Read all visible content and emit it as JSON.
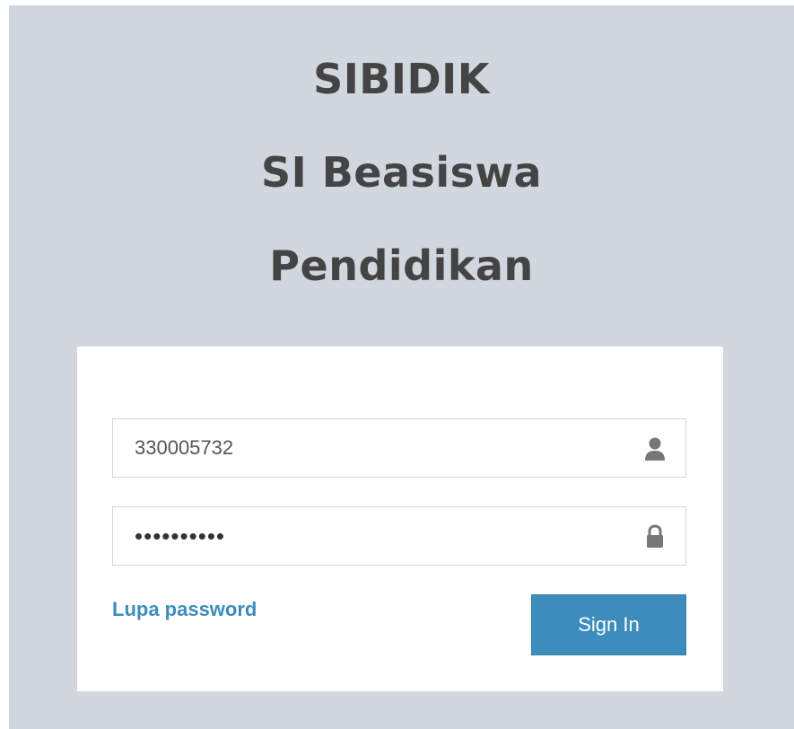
{
  "header": {
    "line1": "SIBIDIK",
    "line2": "SI Beasiswa",
    "line3": "Pendidikan"
  },
  "login": {
    "username_value": "330005732",
    "password_value": "••••••••••",
    "username_icon": "user-icon",
    "password_icon": "lock-icon",
    "forgot_label": "Lupa password",
    "signin_label": "Sign In"
  },
  "colors": {
    "background": "#d2d6de",
    "box": "#ffffff",
    "accent": "#3c8dbc",
    "title": "#444444"
  }
}
